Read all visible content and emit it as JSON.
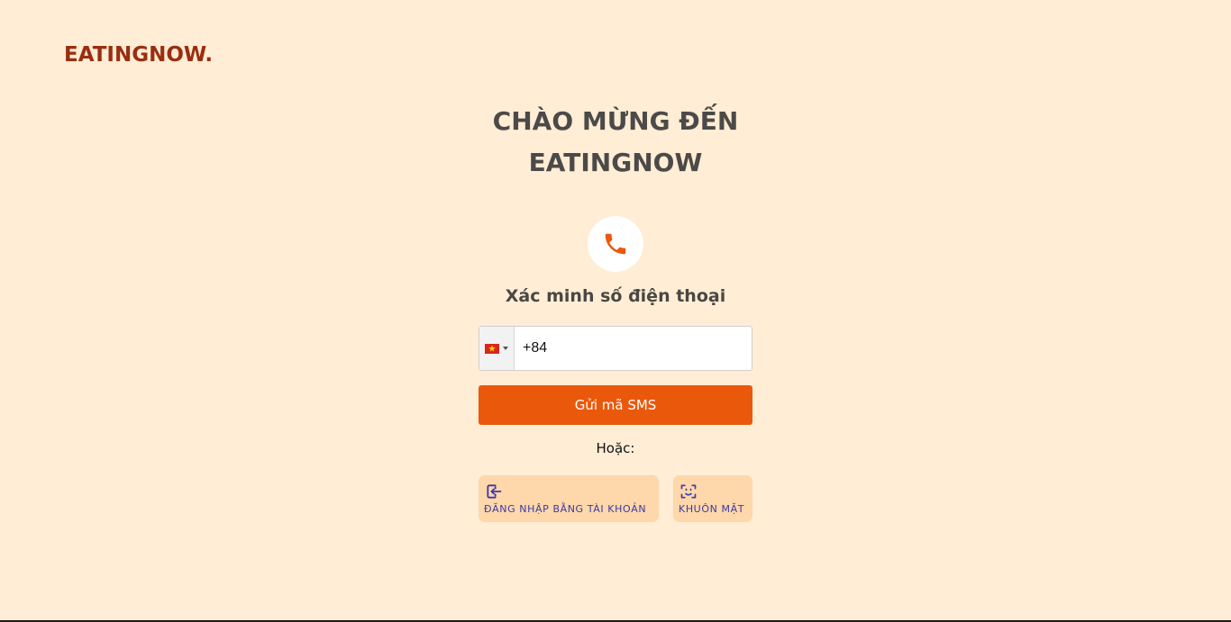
{
  "brand": {
    "logo_text": "EATINGNOW."
  },
  "welcome": {
    "line1": "CHÀO MỪNG ĐẾN",
    "line2": "EATINGNOW"
  },
  "verify": {
    "icon": "phone-icon",
    "title": "Xác minh số điện thoại"
  },
  "phone_field": {
    "country": "VN",
    "flag_icon": "vietnam-flag-icon",
    "value": "+84"
  },
  "sms_button": {
    "label": "Gửi mã SMS"
  },
  "divider": {
    "or_label": "Hoặc:"
  },
  "alternatives": {
    "account_login": {
      "icon": "login-icon",
      "label": "ĐĂNG NHẬP BẰNG TÀI KHOẢN"
    },
    "face_login": {
      "icon": "face-scan-icon",
      "label": "KHUÔN MẶT"
    }
  },
  "colors": {
    "background": "#ffedd5",
    "brand": "#9a2e10",
    "accent": "#ea580c",
    "alt_button_bg": "#fed7aa",
    "alt_button_text": "#3b3aa8",
    "heading": "#4c4a48"
  }
}
